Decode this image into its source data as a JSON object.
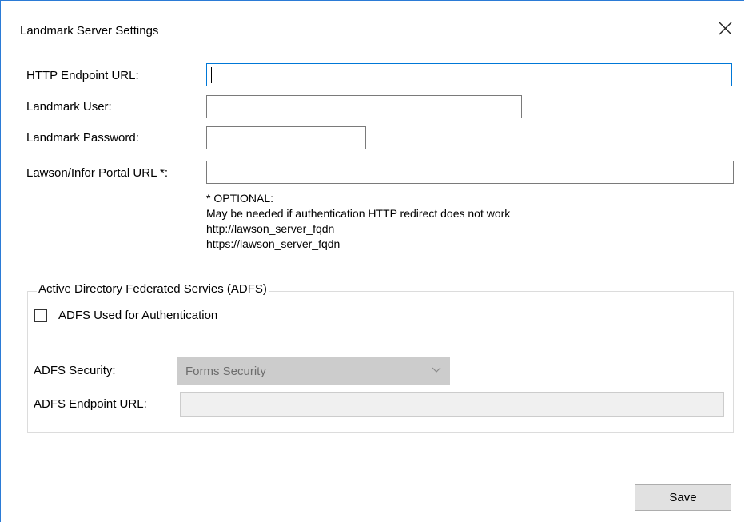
{
  "window": {
    "title": "Landmark Server Settings"
  },
  "fields": {
    "http_endpoint_label": "HTTP Endpoint URL:",
    "http_endpoint_value": "",
    "landmark_user_label": "Landmark User:",
    "landmark_user_value": "",
    "landmark_password_label": "Landmark Password:",
    "landmark_password_value": "",
    "portal_url_label": "Lawson/Infor Portal URL *:",
    "portal_url_value": ""
  },
  "note": {
    "line1": "* OPTIONAL:",
    "line2": "May be needed if authentication HTTP redirect does not work",
    "line3": "http://lawson_server_fqdn",
    "line4": "https://lawson_server_fqdn"
  },
  "adfs": {
    "group_title": "Active Directory Federated Servies (ADFS)",
    "checkbox_label": "ADFS Used for Authentication",
    "checkbox_checked": false,
    "security_label": "ADFS Security:",
    "security_value": "Forms Security",
    "endpoint_label": "ADFS Endpoint URL:",
    "endpoint_value": ""
  },
  "buttons": {
    "save_label": "Save"
  },
  "icons": {
    "close": "close-icon",
    "dropdown": "chevron-down-icon"
  },
  "colors": {
    "focus_border": "#0078d7",
    "window_border": "#2b7bd6",
    "disabled_combo": "#cccccc",
    "disabled_box": "#f0f0f0"
  }
}
